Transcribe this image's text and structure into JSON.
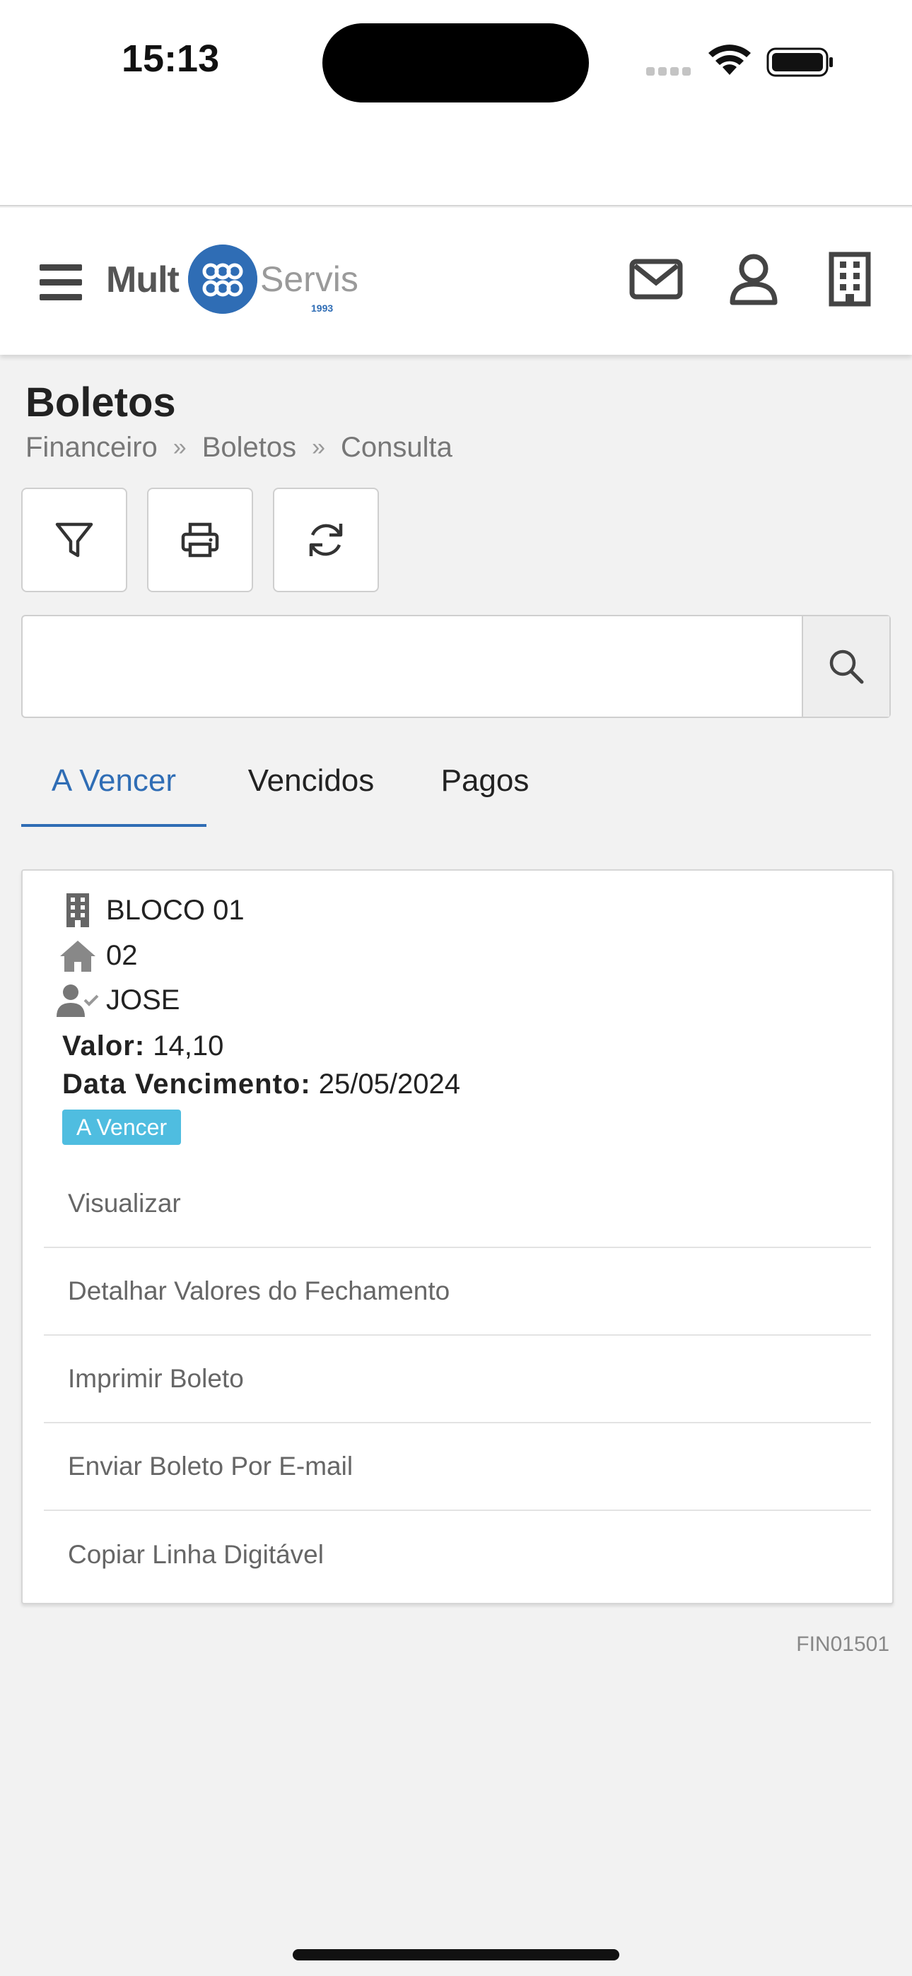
{
  "status_bar": {
    "time": "15:13"
  },
  "header": {
    "logo": {
      "left": "Mult",
      "right": "Servis",
      "since": "desde 1993"
    },
    "icons": [
      "menu-icon",
      "mail-icon",
      "user-icon",
      "building-icon"
    ]
  },
  "page": {
    "title": "Boletos",
    "breadcrumb": [
      "Financeiro",
      "Boletos",
      "Consulta"
    ],
    "breadcrumb_separator": "»"
  },
  "toolbar": {
    "buttons": [
      "filter-icon",
      "print-icon",
      "refresh-icon"
    ]
  },
  "search": {
    "value": "",
    "placeholder": ""
  },
  "tabs": [
    {
      "label": "A Vencer",
      "active": true
    },
    {
      "label": "Vencidos",
      "active": false
    },
    {
      "label": "Pagos",
      "active": false
    }
  ],
  "card": {
    "bloco": "BLOCO 01",
    "unidade": "02",
    "morador": "JOSE",
    "valor_label": "Valor:",
    "valor": "14,10",
    "vencimento_label": "Data Vencimento:",
    "vencimento": "25/05/2024",
    "status": "A Vencer",
    "status_color": "#4fbde0",
    "actions": [
      "Visualizar",
      "Detalhar Valores do Fechamento",
      "Imprimir Boleto",
      "Enviar Boleto Por E-mail",
      "Copiar Linha Digitável"
    ]
  },
  "footer": {
    "page_code": "FIN01501"
  },
  "colors": {
    "accent": "#2f6db5",
    "badge": "#4fbde0",
    "background": "#f2f2f2"
  }
}
